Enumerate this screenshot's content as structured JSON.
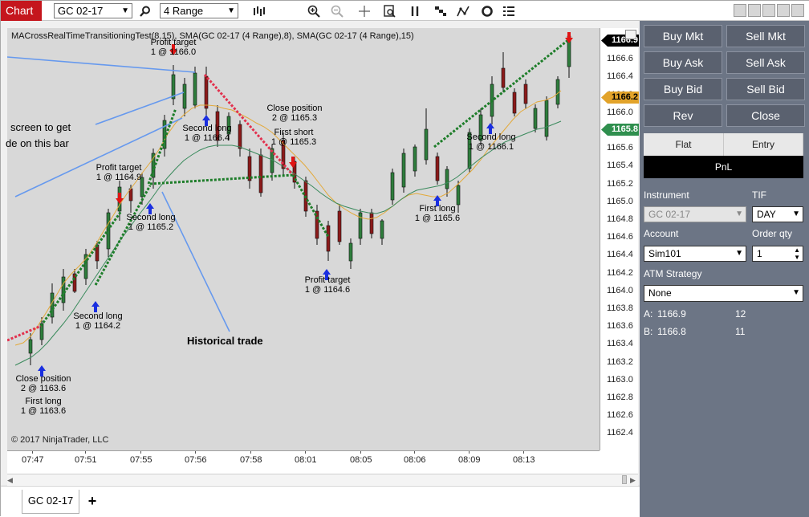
{
  "toolbar": {
    "chart_tab": "Chart",
    "instrument": "GC 02-17",
    "interval": "4 Range",
    "icons": [
      "search-icon",
      "bars-icon",
      "zoom-in-icon",
      "zoom-out-icon",
      "crosshair-icon",
      "data-box-icon",
      "strategy-icon",
      "chart-style-icon",
      "drawing-tools-icon",
      "reload-icon",
      "properties-icon"
    ]
  },
  "chart": {
    "title": "MACrossRealTimeTransitioningTest(8,15), SMA(GC 02-17 (4 Range),8), SMA(GC 02-17 (4 Range),15)",
    "copyright": "© 2017 NinjaTrader, LLC",
    "annotations": {
      "screen_text_1": "screen to get",
      "screen_text_2": "de on this bar",
      "historical_trade": "Historical trade"
    },
    "trade_labels": [
      {
        "l1": "Close position",
        "l2": "2 @ 1163.6"
      },
      {
        "l1": "First long",
        "l2": "1 @ 1163.6"
      },
      {
        "l1": "Second long",
        "l2": "1 @ 1164.2"
      },
      {
        "l1": "Profit target",
        "l2": "1 @ 1164.9"
      },
      {
        "l1": "Second long",
        "l2": "1 @ 1165.2"
      },
      {
        "l1": "Profit target",
        "l2": "1 @ 1166.0"
      },
      {
        "l1": "Second long",
        "l2": "1 @ 1166.4"
      },
      {
        "l1": "Close position",
        "l2": "2 @ 1165.3"
      },
      {
        "l1": "First short",
        "l2": "1 @ 1165.3"
      },
      {
        "l1": "Profit target",
        "l2": "1 @ 1164.6"
      },
      {
        "l1": "First long",
        "l2": "1 @ 1165.6"
      },
      {
        "l1": "Second long",
        "l2": "1 @ 1166.1"
      }
    ],
    "price_labels": [
      "1166.8",
      "1166.6",
      "1166.4",
      "1166.2",
      "1166.0",
      "1165.8",
      "1165.6",
      "1165.4",
      "1165.2",
      "1165.0",
      "1164.8",
      "1164.6",
      "1164.4",
      "1164.2",
      "1164.0",
      "1163.8",
      "1163.6",
      "1163.4",
      "1163.2",
      "1163.0",
      "1162.8",
      "1162.6",
      "1162.4"
    ],
    "price_tags": [
      {
        "value": "1166.9",
        "color": "#000000",
        "text_color": "#ffffff"
      },
      {
        "value": "1166.2",
        "color": "#e2a32a",
        "text_color": "#000000"
      },
      {
        "value": "1165.8",
        "color": "#2f8f4e",
        "text_color": "#ffffff"
      }
    ],
    "time_labels": [
      "07:47",
      "07:51",
      "07:55",
      "07:56",
      "07:58",
      "08:01",
      "08:05",
      "08:06",
      "08:09",
      "08:13"
    ]
  },
  "bottom": {
    "tab": "GC 02-17",
    "add": "+"
  },
  "panel": {
    "buttons": [
      "Buy Mkt",
      "Sell Mkt",
      "Buy Ask",
      "Sell Ask",
      "Buy Bid",
      "Sell Bid",
      "Rev",
      "Close"
    ],
    "position": {
      "flat": "Flat",
      "entry": "Entry",
      "pnl": "PnL"
    },
    "instrument_label": "Instrument",
    "instrument_value": "GC 02-17",
    "tif_label": "TIF",
    "tif_value": "DAY",
    "account_label": "Account",
    "account_value": "Sim101",
    "qty_label": "Order qty",
    "qty_value": "1",
    "atm_label": "ATM Strategy",
    "atm_value": "None",
    "ask_label": "A:",
    "ask_price": "1166.9",
    "ask_size": "12",
    "bid_label": "B:",
    "bid_price": "1166.8",
    "bid_size": "11"
  }
}
